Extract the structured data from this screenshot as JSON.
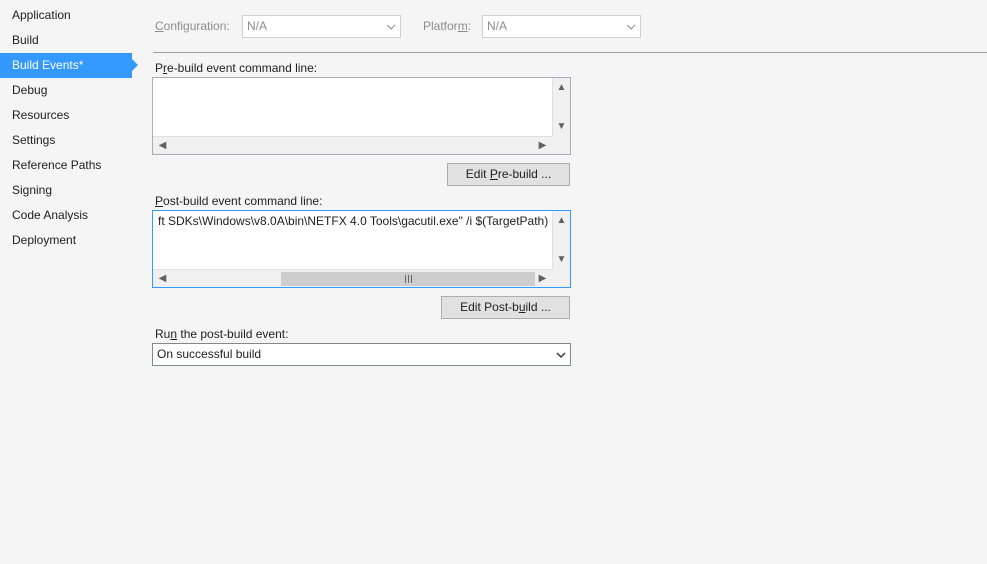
{
  "sidebar": {
    "items": [
      {
        "label": "Application"
      },
      {
        "label": "Build"
      },
      {
        "label": "Build Events*"
      },
      {
        "label": "Debug"
      },
      {
        "label": "Resources"
      },
      {
        "label": "Settings"
      },
      {
        "label": "Reference Paths"
      },
      {
        "label": "Signing"
      },
      {
        "label": "Code Analysis"
      },
      {
        "label": "Deployment"
      }
    ],
    "active_index": 2
  },
  "header": {
    "configuration": {
      "label_first": "C",
      "label_rest": "onfiguration:",
      "value": "N/A"
    },
    "platform": {
      "label_pre": "Platfor",
      "label_ul": "m",
      "label_post": ":",
      "value": "N/A"
    }
  },
  "prebuild": {
    "label_pre": "P",
    "label_ul": "r",
    "label_post": "e-build event command line:",
    "value": "",
    "button": {
      "pre": "Edit ",
      "ul": "P",
      "post": "re-build ..."
    }
  },
  "postbuild": {
    "label_pre": "",
    "label_ul": "P",
    "label_post": "ost-build event command line:",
    "value": "ft SDKs\\Windows\\v8.0A\\bin\\NETFX 4.0 Tools\\gacutil.exe\" /i $(TargetPath)",
    "button": {
      "pre": "Edit Post-b",
      "ul": "u",
      "post": "ild ..."
    }
  },
  "run_event": {
    "label_pre": "Ru",
    "label_ul": "n",
    "label_post": " the post-build event:",
    "value": "On successful build"
  },
  "colors": {
    "accent": "#3399ff",
    "background": "#f5f5f5"
  }
}
